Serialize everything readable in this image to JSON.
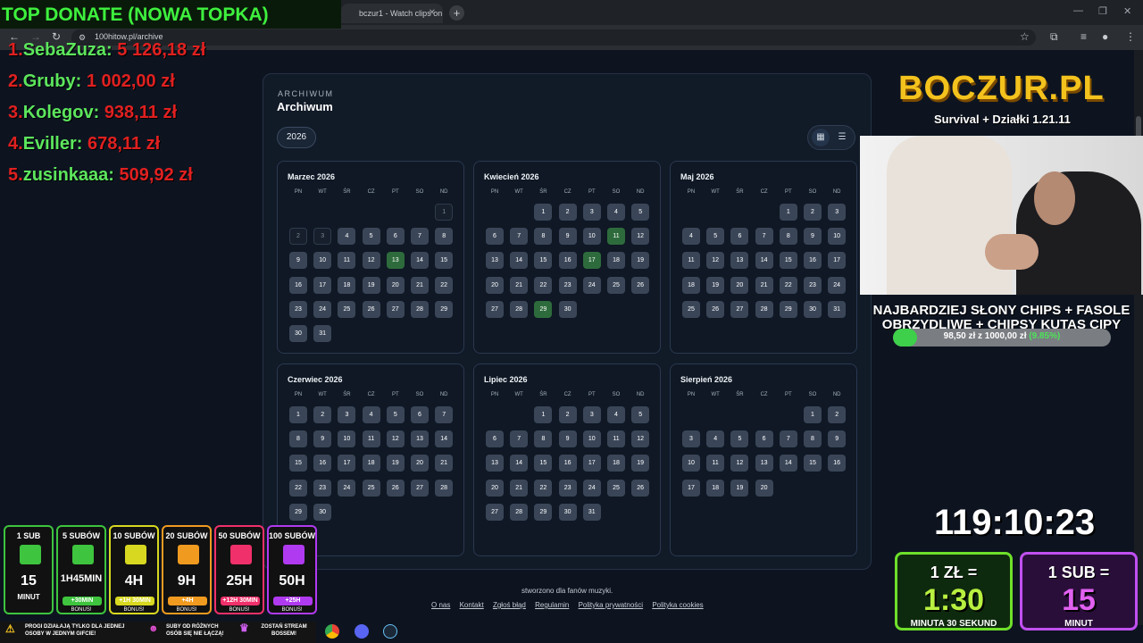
{
  "browser": {
    "tab_title": "bczur1 - Watch clips on Kick",
    "url": "100hitow.pl/archive"
  },
  "page": {
    "eyebrow": "ARCHIWUM",
    "title": "Archiwum",
    "year": "2026",
    "dow": [
      "PN",
      "WT",
      "ŚR",
      "CZ",
      "PT",
      "SO",
      "ND"
    ],
    "months": [
      {
        "name": "Marzec 2026",
        "offset": 6,
        "days": 31,
        "highlight": [
          13
        ],
        "past": [
          1,
          2,
          3
        ]
      },
      {
        "name": "Kwiecień 2026",
        "offset": 2,
        "days": 30,
        "highlight": [
          11,
          17,
          29
        ],
        "past": []
      },
      {
        "name": "Maj 2026",
        "offset": 4,
        "days": 31,
        "highlight": [],
        "past": []
      },
      {
        "name": "Czerwiec 2026",
        "offset": 0,
        "days": 30,
        "highlight": [],
        "past": []
      },
      {
        "name": "Lipiec 2026",
        "offset": 2,
        "days": 31,
        "highlight": [],
        "past": []
      },
      {
        "name": "Sierpień 2026",
        "offset": 5,
        "days": 20,
        "highlight": [],
        "past": []
      }
    ],
    "footer": "stworzono dla fanów muzyki.",
    "links": [
      "O nas",
      "Kontakt",
      "Zgłoś błąd",
      "Regulamin",
      "Polityka prywatności",
      "Polityka cookies"
    ]
  },
  "overlay": {
    "top_donate": "TOP DONATE (NOWA TOPKA)",
    "donors": [
      {
        "rank": "1.",
        "name": "SebaZuza:",
        "amount": "5 126,18 zł"
      },
      {
        "rank": "2.",
        "name": "Gruby:",
        "amount": "1 002,00 zł"
      },
      {
        "rank": "3.",
        "name": "Kolegov:",
        "amount": "938,11 zł"
      },
      {
        "rank": "4.",
        "name": "Eviller:",
        "amount": "678,11 zł"
      },
      {
        "rank": "5.",
        "name": "zusinkaaa:",
        "amount": "509,92 zł"
      }
    ],
    "logo": "BOCZUR.PL",
    "logo_sub": "Survival + Działki 1.21.11",
    "goal_title": "NAJBARDZIEJ SŁONY CHIPS + FASOLE OBRZYDLIWE + CHIPSY KUTAS CIPY",
    "goal_progress": "98,50 zł z 1000,00 zł",
    "goal_percent": "(9.85%)",
    "goal_fraction": 0.0985,
    "timer": "119:10:23",
    "tiers": [
      {
        "label": "1 SUB",
        "value": "15",
        "unit": "MINUT",
        "bonus": "",
        "color": "#3ec43e"
      },
      {
        "label": "5 SUBÓW",
        "value": "1H45MIN",
        "unit": "",
        "bonus": "+30MIN",
        "color": "#3ec43e"
      },
      {
        "label": "10 SUBÓW",
        "value": "4H",
        "unit": "",
        "bonus": "+1H 30MIN",
        "color": "#d8d820"
      },
      {
        "label": "20 SUBÓW",
        "value": "9H",
        "unit": "",
        "bonus": "+4H",
        "color": "#f09a20"
      },
      {
        "label": "50 SUBÓW",
        "value": "25H",
        "unit": "",
        "bonus": "+12H 30MIN",
        "color": "#f0306a"
      },
      {
        "label": "100 SUBÓW",
        "value": "50H",
        "unit": "",
        "bonus": "+25H",
        "color": "#b03af0"
      }
    ],
    "bonus_text": "BONUS!",
    "info1": "PROGI DZIAŁAJĄ TYLKO DLA JEDNEJ OSOBY W JEDNYM GIFCIE!",
    "info2": "SUBY OD RÓŻNYCH OSÓB SIĘ NIE ŁĄCZĄ!",
    "info3": "ZOSTAŃ STREAM BOSSEM!",
    "promo1": {
      "title": "1 ZŁ =",
      "big": "1:30",
      "sub": "MINUTA 30 SEKUND"
    },
    "promo2": {
      "title": "1 SUB =",
      "big": "15",
      "sub": "MINUT"
    }
  }
}
